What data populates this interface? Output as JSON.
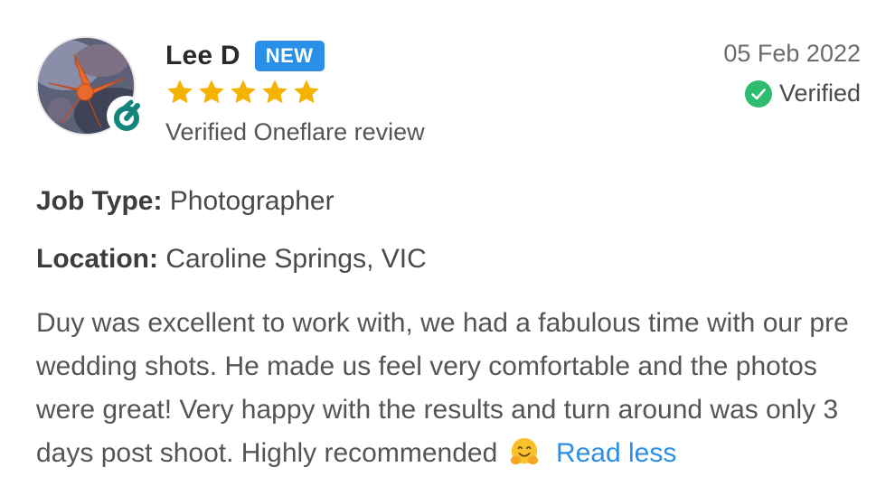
{
  "review": {
    "reviewer_name": "Lee D",
    "badge": "NEW",
    "rating": 5,
    "rating_max": 5,
    "source_text": "Verified Oneflare review",
    "date": "05 Feb 2022",
    "verified_label": "Verified",
    "job_type_label": "Job Type:",
    "job_type": "Photographer",
    "location_label": "Location:",
    "location": "Caroline Springs, VIC",
    "text": "Duy was excellent to work with, we had a fabulous time with our pre wedding shots. He made us feel very comfortable and the photos were great! Very happy with the results and turn around was only 3 days post shoot. Highly recommended",
    "emoji": "hugging-face",
    "read_less_label": "Read less"
  },
  "colors": {
    "accent_blue": "#2a8fe6",
    "star_gold": "#f5b301",
    "verified_green": "#2ebd6e",
    "brand_teal": "#14857c"
  },
  "icons": {
    "avatar": "starfish-photo-avatar",
    "brand": "oneflare-logo-icon",
    "verified": "check-circle-icon",
    "star": "star-icon"
  }
}
